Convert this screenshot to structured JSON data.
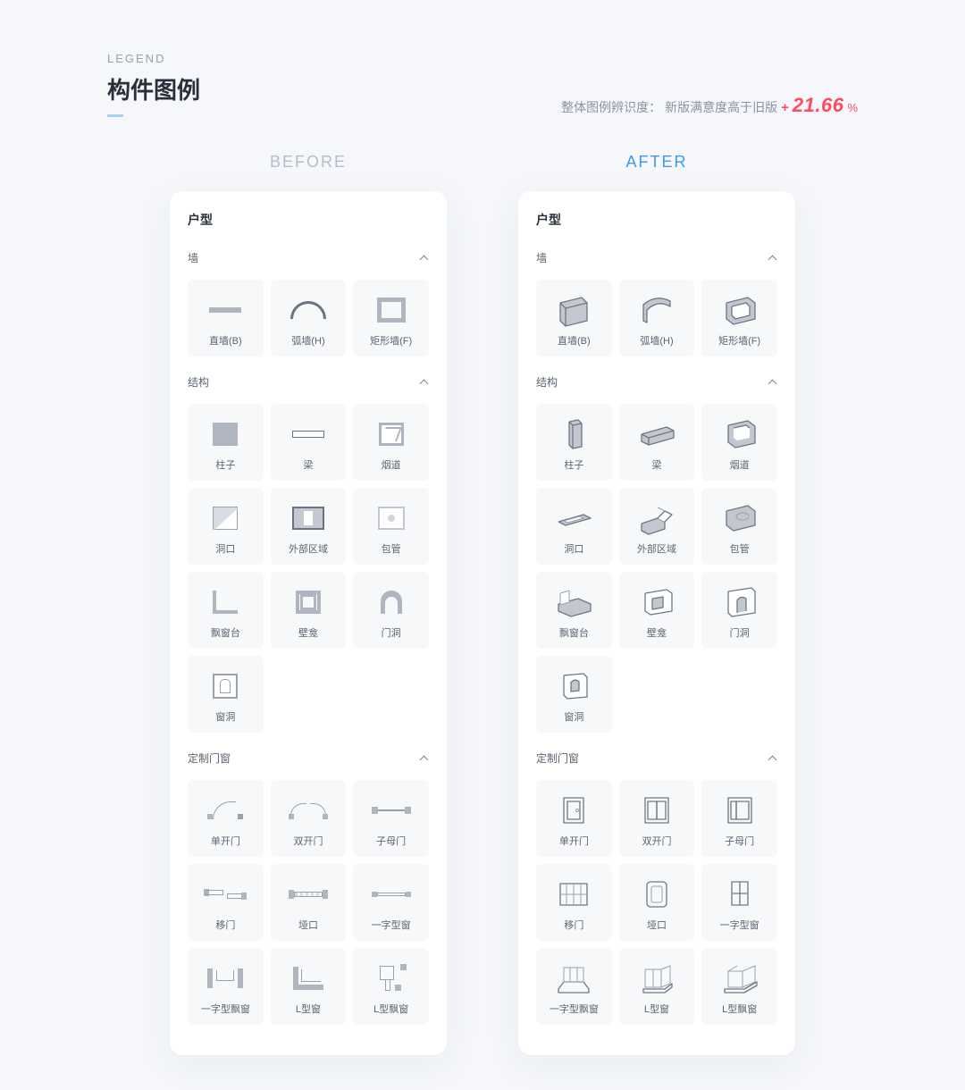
{
  "header": {
    "eyebrow": "LEGEND",
    "title": "构件图例",
    "note_prefix": "整体图例辨识度：",
    "note_text": "新版满意度高于旧版",
    "delta_plus": "+",
    "delta_value": "21.66",
    "delta_suffix": "%"
  },
  "columns": {
    "before_label": "BEFORE",
    "after_label": "AFTER"
  },
  "panel_title": "户型",
  "sections": [
    {
      "name": "墙",
      "items": [
        "直墙(B)",
        "弧墙(H)",
        "矩形墙(F)"
      ]
    },
    {
      "name": "结构",
      "items": [
        "柱子",
        "梁",
        "烟道",
        "洞口",
        "外部区域",
        "包管",
        "飘窗台",
        "壁龛",
        "门洞",
        "窗洞"
      ]
    },
    {
      "name": "定制门窗",
      "items": [
        "单开门",
        "双开门",
        "子母门",
        "移门",
        "垭口",
        "一字型窗",
        "一字型飘窗",
        "L型窗",
        "L型飘窗"
      ]
    }
  ]
}
